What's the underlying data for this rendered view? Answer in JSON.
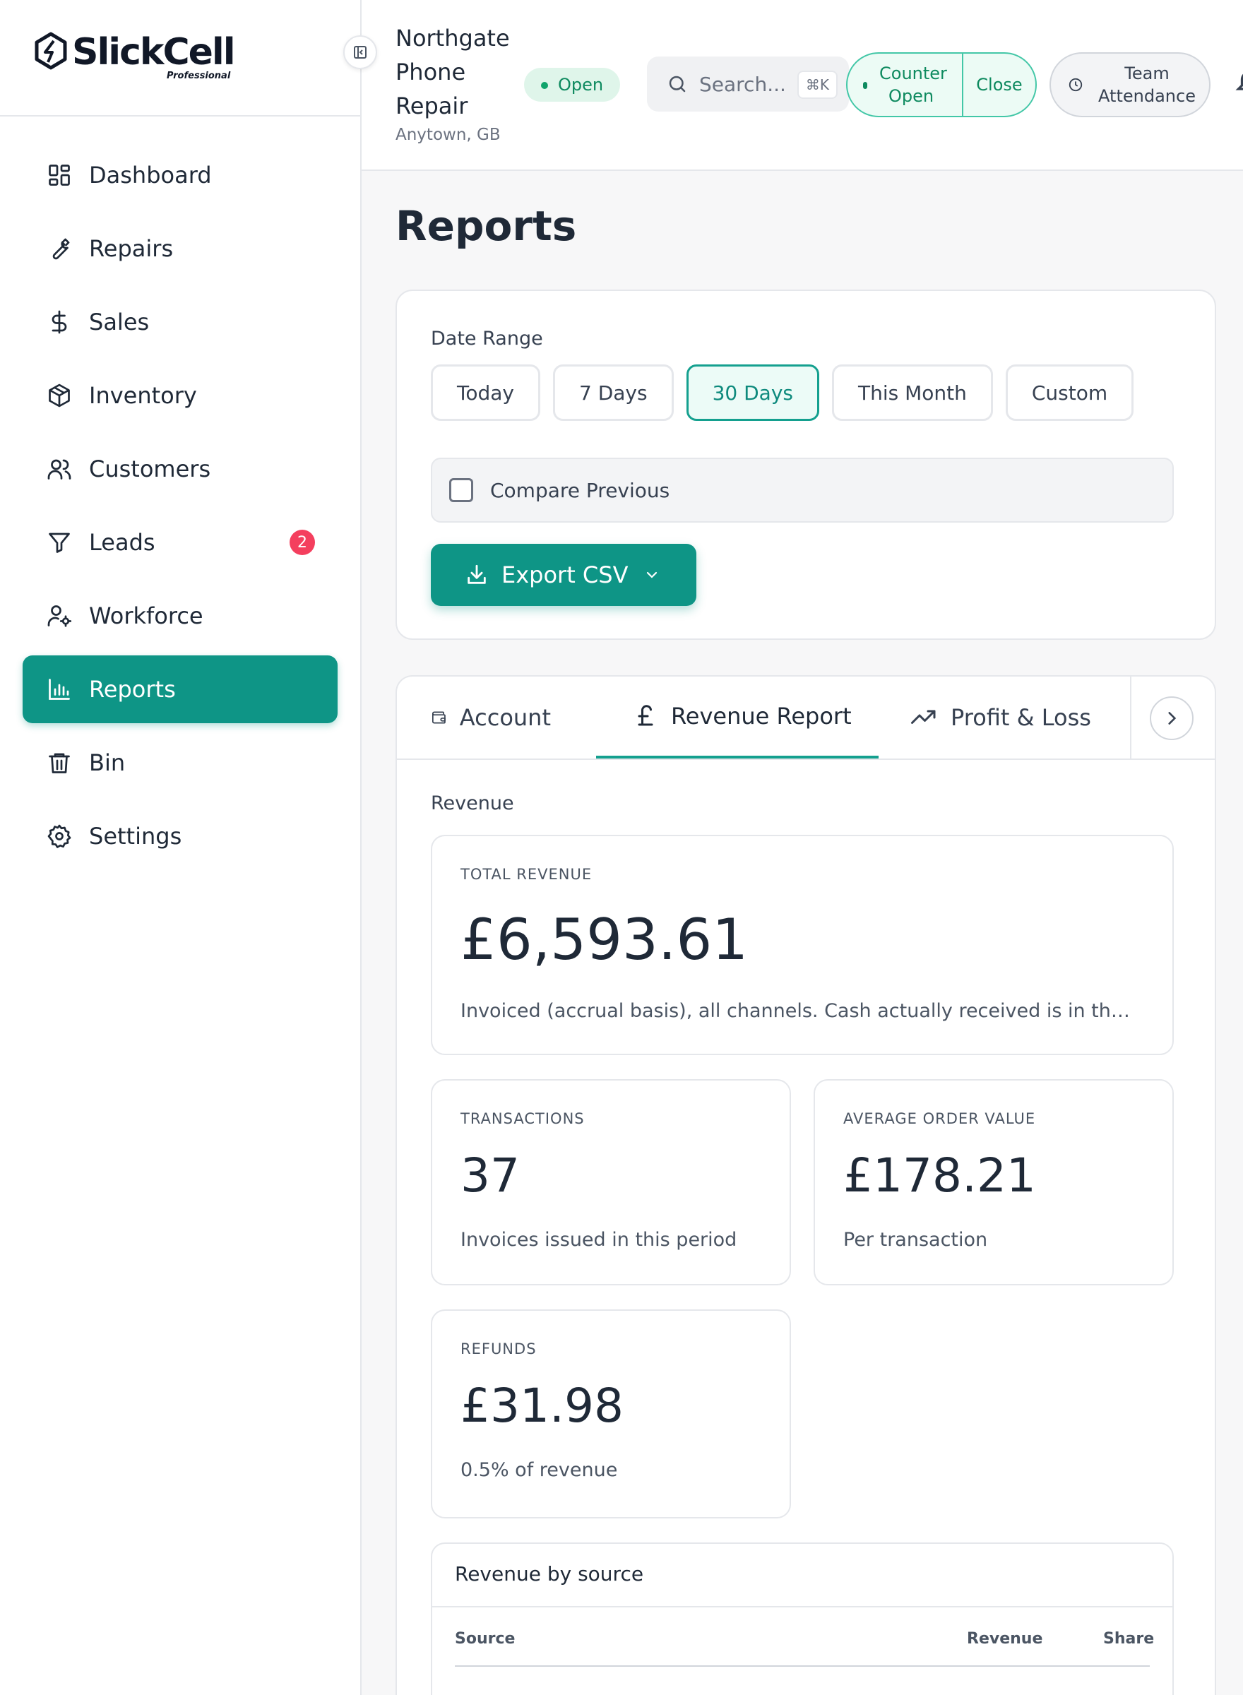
{
  "brand": {
    "name": "SlickCell",
    "tier": "Professional"
  },
  "sidebar": {
    "items": [
      {
        "label": "Dashboard",
        "icon": "dashboard-icon"
      },
      {
        "label": "Repairs",
        "icon": "wrench-icon"
      },
      {
        "label": "Sales",
        "icon": "dollar-icon"
      },
      {
        "label": "Inventory",
        "icon": "box-icon"
      },
      {
        "label": "Customers",
        "icon": "users-icon"
      },
      {
        "label": "Leads",
        "icon": "funnel-icon",
        "badge": "2"
      },
      {
        "label": "Workforce",
        "icon": "user-gear-icon"
      },
      {
        "label": "Reports",
        "icon": "bar-chart-icon",
        "active": true
      },
      {
        "label": "Bin",
        "icon": "trash-icon"
      },
      {
        "label": "Settings",
        "icon": "gear-icon"
      }
    ]
  },
  "header": {
    "store_name": "Northgate Phone Repair",
    "store_location": "Anytown, GB",
    "status": "Open",
    "search_placeholder": "Search...",
    "search_shortcut": "⌘K",
    "counter_status": "Counter Open",
    "counter_action": "Close",
    "attendance_label": "Team Attendance"
  },
  "page": {
    "title": "Reports"
  },
  "filters": {
    "date_range_label": "Date Range",
    "ranges": [
      "Today",
      "7 Days",
      "30 Days",
      "This Month",
      "Custom"
    ],
    "selected_range": "30 Days",
    "compare_label": "Compare Previous",
    "compare_checked": false,
    "export_label": "Export CSV"
  },
  "tabs": [
    {
      "label": "Account",
      "icon": "wallet-icon"
    },
    {
      "label": "Revenue Report",
      "icon": "pound-icon",
      "active": true
    },
    {
      "label": "Profit & Loss",
      "icon": "trend-up-icon"
    }
  ],
  "revenue": {
    "section_label": "Revenue",
    "total": {
      "caption": "TOTAL REVENUE",
      "value": "£6,593.61",
      "note": "Invoiced (accrual basis), all channels. Cash actually received is in the Account tab."
    },
    "transactions": {
      "caption": "TRANSACTIONS",
      "value": "37",
      "note": "Invoices issued in this period"
    },
    "aov": {
      "caption": "AVERAGE ORDER VALUE",
      "value": "£178.21",
      "note": "Per transaction"
    },
    "refunds": {
      "caption": "REFUNDS",
      "value": "£31.98",
      "note": "0.5% of revenue"
    }
  },
  "source_table": {
    "title": "Revenue by source",
    "columns": [
      "Source",
      "Revenue",
      "Share"
    ]
  },
  "colors": {
    "accent": "#0e9586",
    "open_green": "#0e8a5f",
    "badge_red": "#f43f5e"
  }
}
